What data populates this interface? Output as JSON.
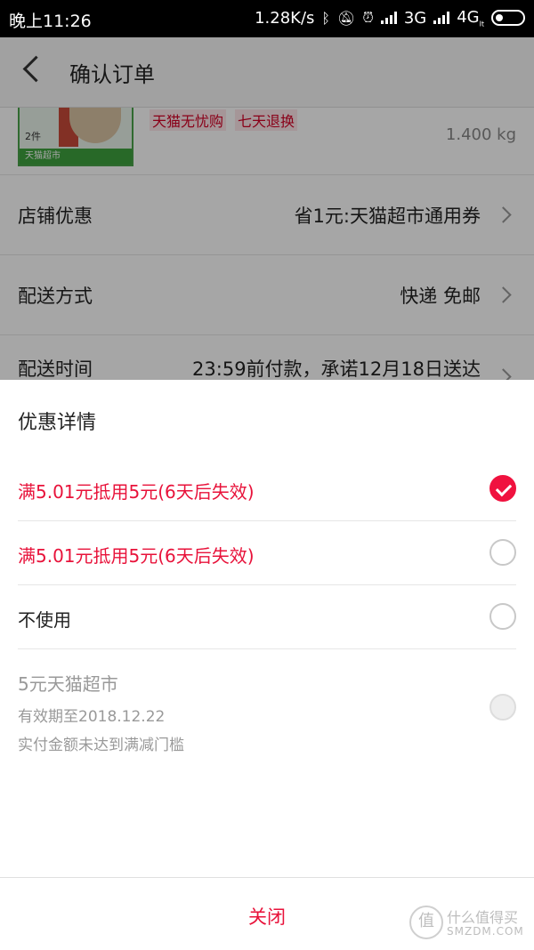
{
  "status_bar": {
    "time": "晚上11:26",
    "speed": "1.28K/s",
    "network1": "3G",
    "network2": "4G",
    "network2_sub": "lt"
  },
  "nav": {
    "title": "确认订单"
  },
  "product": {
    "qty": "2件",
    "img_footer": "天猫超市",
    "tags": [
      "天猫无忧购",
      "七天退换"
    ],
    "weight": "1.400 kg"
  },
  "rows": [
    {
      "label": "店铺优惠",
      "value": "省1元:天猫超市通用券"
    },
    {
      "label": "配送方式",
      "value": "快递 免邮"
    },
    {
      "label": "配送时间",
      "value": "23:59前付款，承诺12月18日送达"
    }
  ],
  "sheet": {
    "heading": "优惠详情",
    "options": [
      {
        "text": "满5.01元抵用5元(6天后失效)",
        "state": "checked"
      },
      {
        "text": "满5.01元抵用5元(6天后失效)",
        "state": "unchecked"
      },
      {
        "text": "不使用",
        "state": "unchecked"
      }
    ],
    "disabled_option": {
      "title": "5元天猫超市",
      "expiry": "有效期至2018.12.22",
      "note": "实付金额未达到满减门槛"
    },
    "close_label": "关闭"
  },
  "watermark": {
    "icon_char": "值",
    "line1": "什么值得买",
    "line2": "SMZDM.COM"
  },
  "colors": {
    "accent": "#e8123a",
    "check_fill": "#f0123f"
  }
}
